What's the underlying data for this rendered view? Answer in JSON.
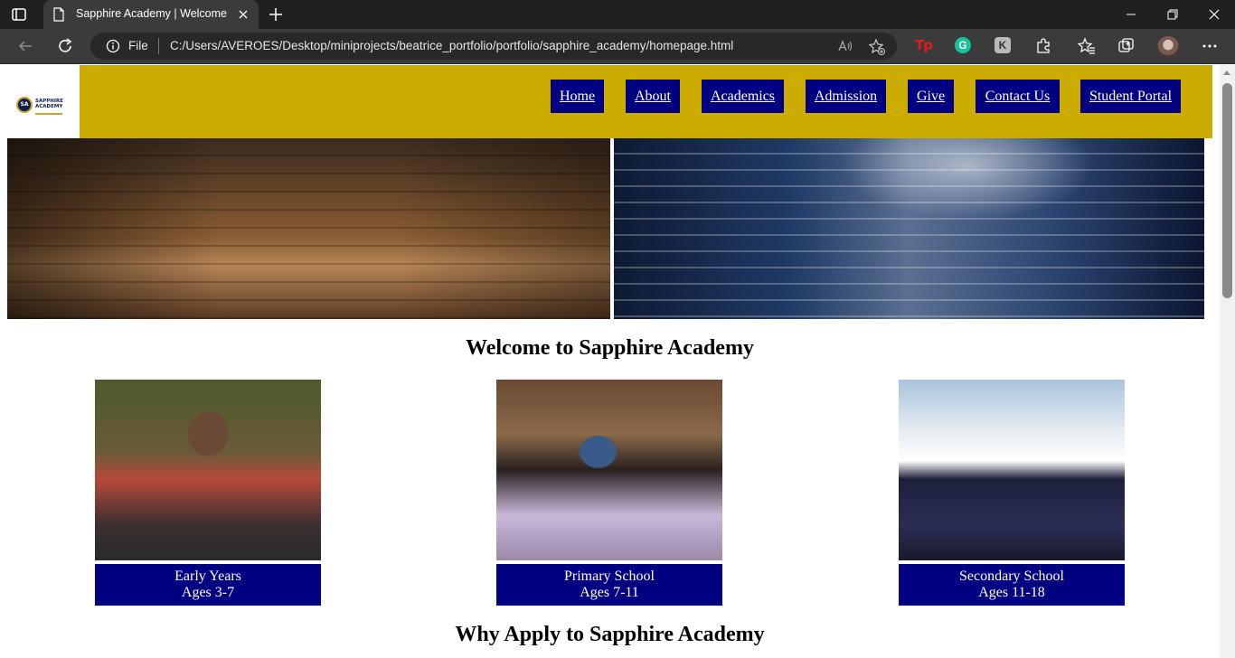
{
  "browser": {
    "tab_title": "Sapphire Academy | Welcome",
    "address_label": "File",
    "url": "C:/Users/AVEROES/Desktop/miniprojects/beatrice_portfolio/portfolio/sapphire_academy/homepage.html",
    "extensions": {
      "tp": "Tp",
      "grammarly": "G",
      "k": "K"
    }
  },
  "site": {
    "logo": {
      "badge": "SA",
      "name": "SAPPHIRE ACADEMY"
    },
    "nav": [
      {
        "label": "Home"
      },
      {
        "label": "About"
      },
      {
        "label": "Academics"
      },
      {
        "label": "Admission"
      },
      {
        "label": "Give"
      },
      {
        "label": "Contact Us"
      },
      {
        "label": "Student Portal"
      }
    ],
    "welcome_heading": "Welcome to Sapphire Academy",
    "cards": [
      {
        "title": "Early Years",
        "ages": "Ages 3-7"
      },
      {
        "title": "Primary School",
        "ages": "Ages 7-11"
      },
      {
        "title": "Secondary School",
        "ages": "Ages 11-18"
      }
    ],
    "why_heading": "Why Apply to Sapphire Academy"
  },
  "colors": {
    "navbar": "#ccac00",
    "nav_button": "#000080",
    "card_label": "#000080"
  }
}
